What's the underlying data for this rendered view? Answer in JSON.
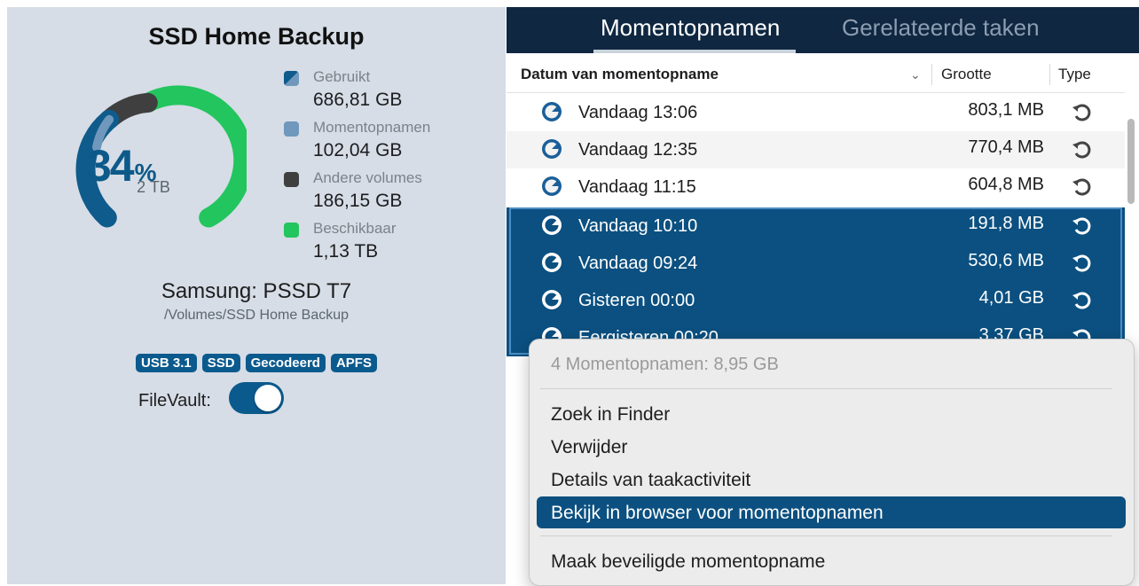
{
  "disk": {
    "title": "SSD Home Backup",
    "usage": {
      "percent_number": "34",
      "percent_symbol": "%",
      "capacity": "2 TB",
      "used_fraction": 0.34
    },
    "legend": [
      {
        "name": "Gebruikt",
        "value": "686,81 GB",
        "color": "#0f5b8c"
      },
      {
        "name": "Momentopnamen",
        "value": "102,04 GB",
        "color": "#6f98bc"
      },
      {
        "name": "Andere volumes",
        "value": "186,15 GB",
        "color": "#3f3f3f"
      },
      {
        "name": "Beschikbaar",
        "value": "1,13 TB",
        "color": "#23c55e"
      }
    ],
    "model": "Samsung: PSSD T7",
    "mount_path": "/Volumes/SSD Home Backup",
    "badges": [
      "USB 3.1",
      "SSD",
      "Gecodeerd",
      "APFS"
    ],
    "filevault": {
      "label": "FileVault:",
      "enabled": true
    }
  },
  "tabs": [
    {
      "label": "Momentopnamen",
      "active": true
    },
    {
      "label": "Gerelateerde taken",
      "active": false
    }
  ],
  "table": {
    "columns": {
      "date": "Datum van momentopname",
      "size": "Grootte",
      "type": "Type"
    },
    "sort_icon": "chevron-down-icon",
    "rows": [
      {
        "name": "Vandaag 13:06",
        "size": "803,1 MB",
        "selected": false
      },
      {
        "name": "Vandaag 12:35",
        "size": "770,4 MB",
        "selected": false
      },
      {
        "name": "Vandaag 11:15",
        "size": "604,8 MB",
        "selected": false
      },
      {
        "name": "Vandaag 10:10",
        "size": "191,8 MB",
        "selected": true
      },
      {
        "name": "Vandaag 09:24",
        "size": "530,6 MB",
        "selected": true
      },
      {
        "name": "Gisteren 00:00",
        "size": "4,01 GB",
        "selected": true
      },
      {
        "name": "Eergisteren 00:20",
        "size": "3,37 GB",
        "selected": true
      }
    ]
  },
  "context_menu": {
    "summary": "4 Momentopnamen: 8,95 GB",
    "items": [
      {
        "label": "Zoek in Finder",
        "highlighted": false
      },
      {
        "label": "Verwijder",
        "highlighted": false
      },
      {
        "label": "Details van taakactiviteit",
        "highlighted": false
      },
      {
        "label": "Bekijk in browser voor momentopnamen",
        "highlighted": true
      },
      {
        "label": "Maak beveiligde momentopname",
        "highlighted": false
      }
    ]
  },
  "colors": {
    "accent": "#0b5080",
    "tabbar": "#0f2741",
    "left_panel": "#d6dde6"
  }
}
